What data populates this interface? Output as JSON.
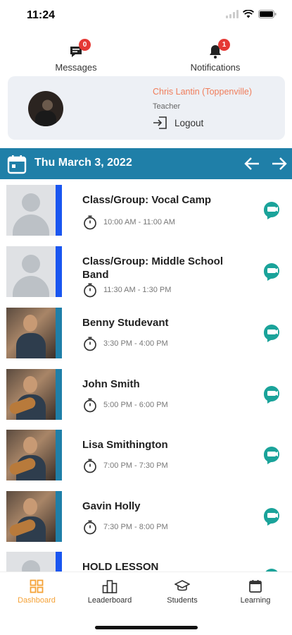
{
  "status": {
    "time": "11:24"
  },
  "nav": {
    "messages": {
      "label": "Messages",
      "badge": "0"
    },
    "notifications": {
      "label": "Notifications",
      "badge": "1"
    }
  },
  "profile": {
    "name": "Chris Lantin (Toppenville)",
    "role": "Teacher",
    "logout_label": "Logout"
  },
  "date_bar": {
    "date": "Thu March 3, 2022"
  },
  "lessons": [
    {
      "title": "Class/Group: Vocal Camp",
      "time": "10:00 AM - 11:00 AM",
      "stripe": "#1a56f0"
    },
    {
      "title": "Class/Group: Middle School Band",
      "time": "11:30 AM - 1:30 PM",
      "stripe": "#1a56f0"
    },
    {
      "title": "Benny Studevant",
      "time": "3:30 PM - 4:00 PM",
      "stripe": "#1f7fa8"
    },
    {
      "title": "John Smith",
      "time": "5:00 PM - 6:00 PM",
      "stripe": "#1f7fa8"
    },
    {
      "title": "Lisa Smithington",
      "time": "7:00 PM - 7:30 PM",
      "stripe": "#1f7fa8"
    },
    {
      "title": "Gavin Holly",
      "time": "7:30 PM - 8:00 PM",
      "stripe": "#1f7fa8"
    },
    {
      "title": "HOLD LESSON",
      "time": "",
      "stripe": "#1a56f0"
    }
  ],
  "tabs": {
    "dashboard": "Dashboard",
    "leaderboard": "Leaderboard",
    "students": "Students",
    "learning": "Learning"
  },
  "colors": {
    "accent": "#1f7fa8",
    "active_tab": "#f5a237",
    "chat_icon": "#1aa39a",
    "badge": "#e53935",
    "profile_name": "#f07d5b"
  }
}
